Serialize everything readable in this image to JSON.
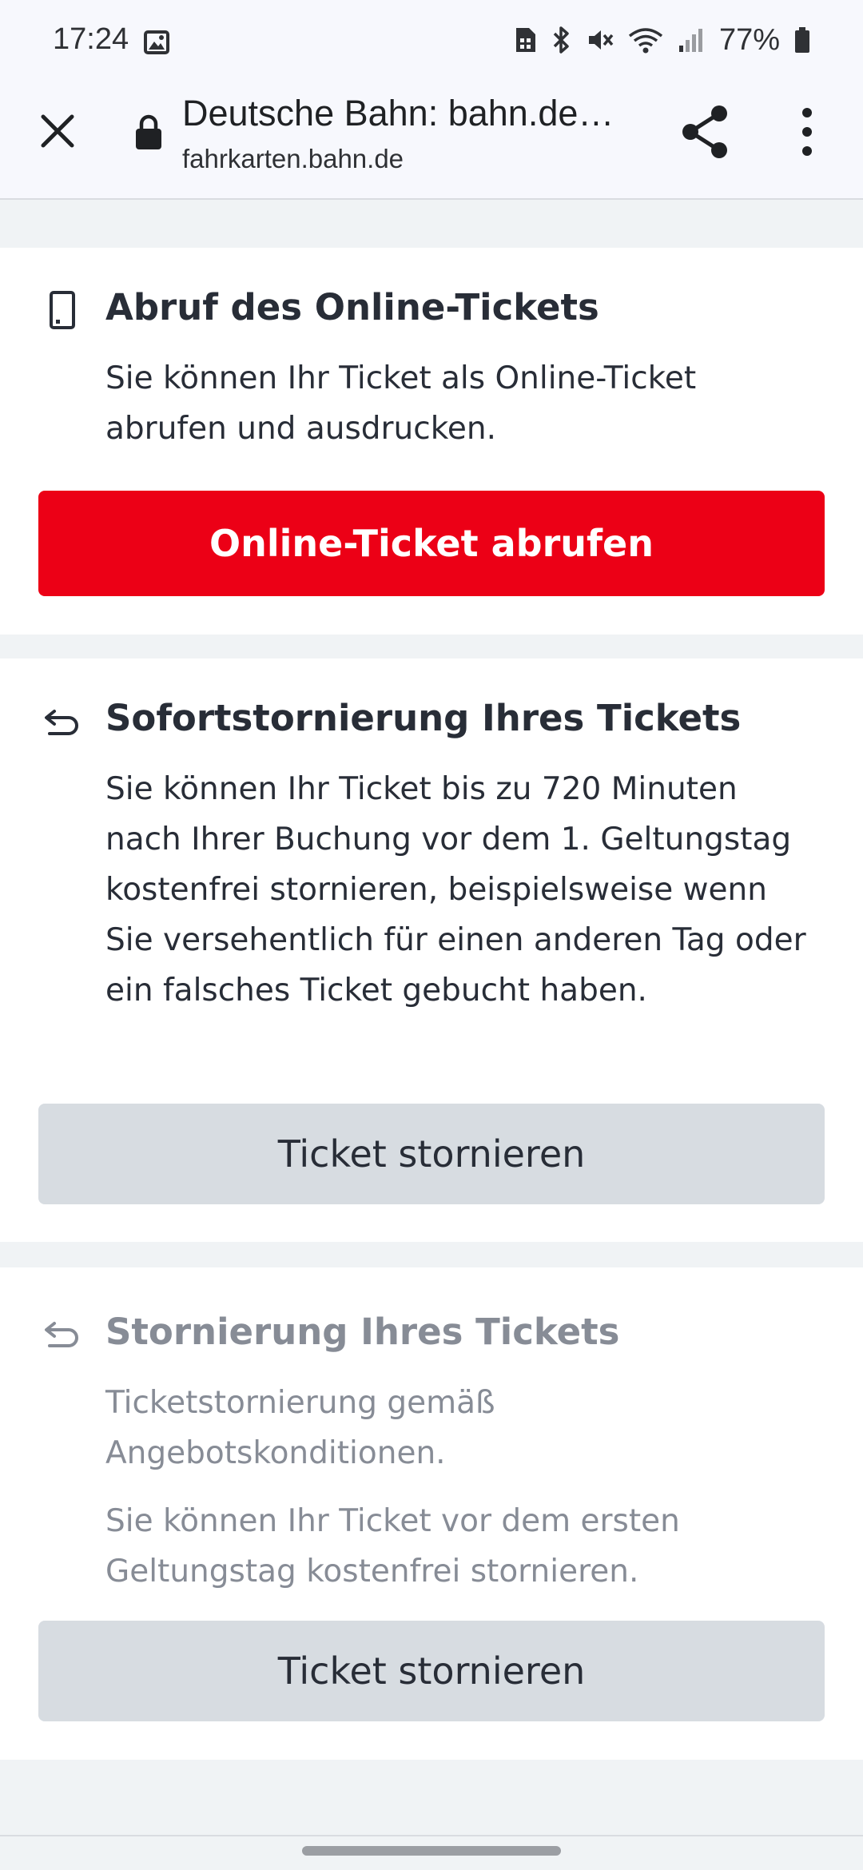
{
  "status_bar": {
    "time": "17:24",
    "battery_percent": "77%",
    "icons": [
      "gallery-icon",
      "sim-icon",
      "bluetooth-icon",
      "mute-icon",
      "wifi-icon",
      "signal-icon",
      "battery-icon"
    ]
  },
  "browser": {
    "title": "Deutsche Bahn: bahn.de…",
    "url": "fahrkarten.bahn.de"
  },
  "online_ticket": {
    "title": "Abruf des Online-Tickets",
    "text": "Sie können Ihr Ticket als Online-Ticket abrufen und ausdrucken.",
    "button": "Online-Ticket abrufen"
  },
  "instant_cancel": {
    "title": "Sofortstornierung Ihres Tickets",
    "text": "Sie können Ihr Ticket bis zu 720 Minuten nach Ihrer Buchung vor dem 1. Geltungstag kostenfrei stornieren, beispielsweise wenn Sie versehentlich für einen anderen Tag oder ein falsches Ticket gebucht haben.",
    "button": "Ticket stornieren"
  },
  "cancel": {
    "title": "Stornierung Ihres Tickets",
    "text1": "Ticketstornierung gemäß Angebotskonditionen.",
    "text2": "Sie können Ihr Ticket vor dem ersten Geltungstag kostenfrei stornieren.",
    "button": "Ticket stornieren"
  },
  "colors": {
    "primary_red": "#ec0016",
    "secondary_button": "#d7dce1",
    "text_dark": "#282d37",
    "text_muted": "#878c96",
    "page_background": "#f0f3f5"
  }
}
